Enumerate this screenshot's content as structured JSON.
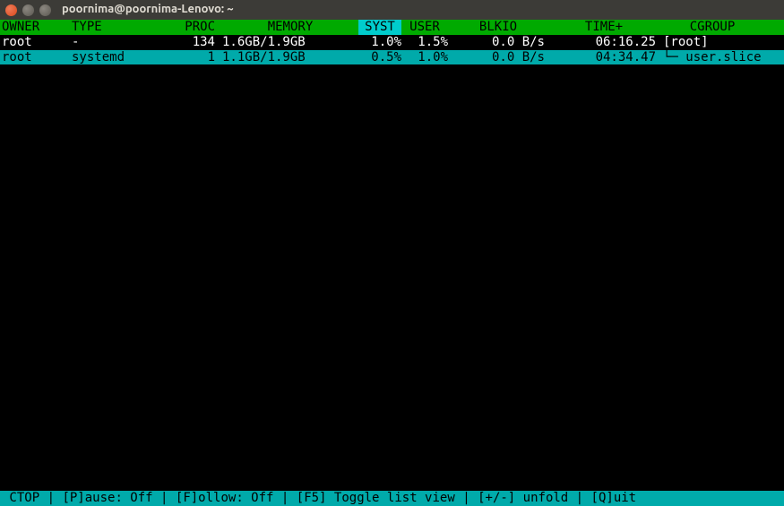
{
  "window": {
    "title": "poornima@poornima-Lenovo: ~"
  },
  "headers": {
    "owner": "OWNER",
    "type": "TYPE",
    "proc": "PROC",
    "memory": "MEMORY",
    "syst": "SYST",
    "user": "USER",
    "blkio": "BLKIO",
    "time": "TIME+",
    "cgroup": "CGROUP"
  },
  "rows": [
    {
      "owner": "root",
      "type": "-",
      "proc": "134",
      "memory": "1.6GB/1.9GB",
      "syst": "1.0%",
      "user": "1.5%",
      "blkio": "0.0 B/s",
      "time": "06:16.25",
      "cgroup": "[root]"
    },
    {
      "owner": "root",
      "type": "systemd",
      "proc": "1",
      "memory": "1.1GB/1.9GB",
      "syst": "0.5%",
      "user": "1.0%",
      "blkio": "0.0 B/s",
      "time": "04:34.47",
      "cgroup": "└─ user.slice"
    }
  ],
  "footer": {
    "app": " CTOP ",
    "pause": " [P]ause: Off ",
    "follow": " [F]ollow: Off ",
    "toggle": " [F5] Toggle list view ",
    "unfold": " [+/-] unfold ",
    "quit": " [Q]uit "
  }
}
